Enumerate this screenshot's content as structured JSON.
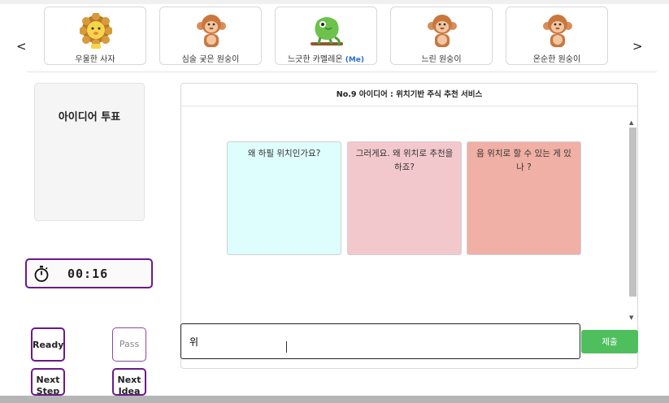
{
  "nav": {
    "prev_label": "<",
    "next_label": ">"
  },
  "avatars": [
    {
      "name": "우울한 사자",
      "icon": "lion-icon",
      "is_me": false
    },
    {
      "name": "심술 궂은 원숭이",
      "icon": "monkey-icon",
      "is_me": false
    },
    {
      "name": "느긋한 카멜레온",
      "icon": "chameleon-icon",
      "is_me": true,
      "me_label": "(Me)"
    },
    {
      "name": "느린 원숭이",
      "icon": "monkey-icon",
      "is_me": false
    },
    {
      "name": "온순한 원숭이",
      "icon": "monkey-icon",
      "is_me": false
    }
  ],
  "sidebar": {
    "vote_title": "아이디어 투표",
    "timer": {
      "icon": "stopwatch-icon",
      "time": "00:16"
    },
    "buttons": {
      "ready": "Ready",
      "pass": "Pass",
      "next_step": "Next Step",
      "next_idea": "Next Idea"
    }
  },
  "panel": {
    "title": "No.9 아이디어 : 위치기반 주식 추천 서비스",
    "notes": [
      {
        "text": "왜 하필 위치인가요?",
        "color": "#defdfd"
      },
      {
        "text": "그러게요. 왜 위치로 추천을 하죠?",
        "color": "#f3c8cc"
      },
      {
        "text": "음 위치로 할 수 있는 게 있나 ?",
        "color": "#f0b0a5"
      }
    ]
  },
  "input": {
    "value": "위"
  },
  "submit_label": "제출",
  "colors": {
    "accent_border": "#6a1a8a",
    "submit": "#4fbf5e"
  }
}
